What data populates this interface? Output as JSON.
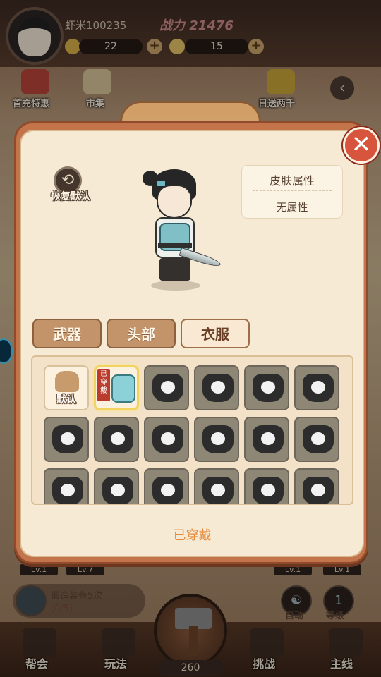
{
  "hud": {
    "player_name": "虾米100235",
    "power": "战力 21476",
    "resource_1": "22",
    "resource_2": "15",
    "add_symbol": "+"
  },
  "top_menu": {
    "items": [
      {
        "label": "首充特惠"
      },
      {
        "label": "市集"
      },
      {
        "label": "日送两千"
      }
    ],
    "arrow": "‹"
  },
  "dialog": {
    "close_symbol": "✕",
    "reset_label": "恢复默认",
    "reset_symbol": "⟲",
    "attribute_title": "皮肤属性",
    "attribute_value": "无属性",
    "tabs": [
      {
        "label": "武器",
        "selected": false
      },
      {
        "label": "头部",
        "selected": false
      },
      {
        "label": "衣服",
        "selected": true
      }
    ],
    "default_cell_label": "默认",
    "worn_tag": "已穿戴",
    "status": "已穿戴"
  },
  "background": {
    "forge_task": "锻造装备5次",
    "forge_count": "(0/5)",
    "lv_labels": [
      "Lv.1",
      "Lv.7",
      "Lv.1",
      "Lv.1"
    ],
    "auto_label": "自动",
    "grade_label": "等级",
    "grade_value": "1",
    "cost": "260",
    "bottom_nav": [
      {
        "label": "帮会"
      },
      {
        "label": "玩法"
      },
      {
        "label": "挑战"
      },
      {
        "label": "主线"
      }
    ]
  },
  "colors": {
    "accent_orange": "#e68a3a",
    "close_red": "#d6553c",
    "dialog_frame": "#c4744a",
    "dialog_bg": "#f6ead5"
  }
}
